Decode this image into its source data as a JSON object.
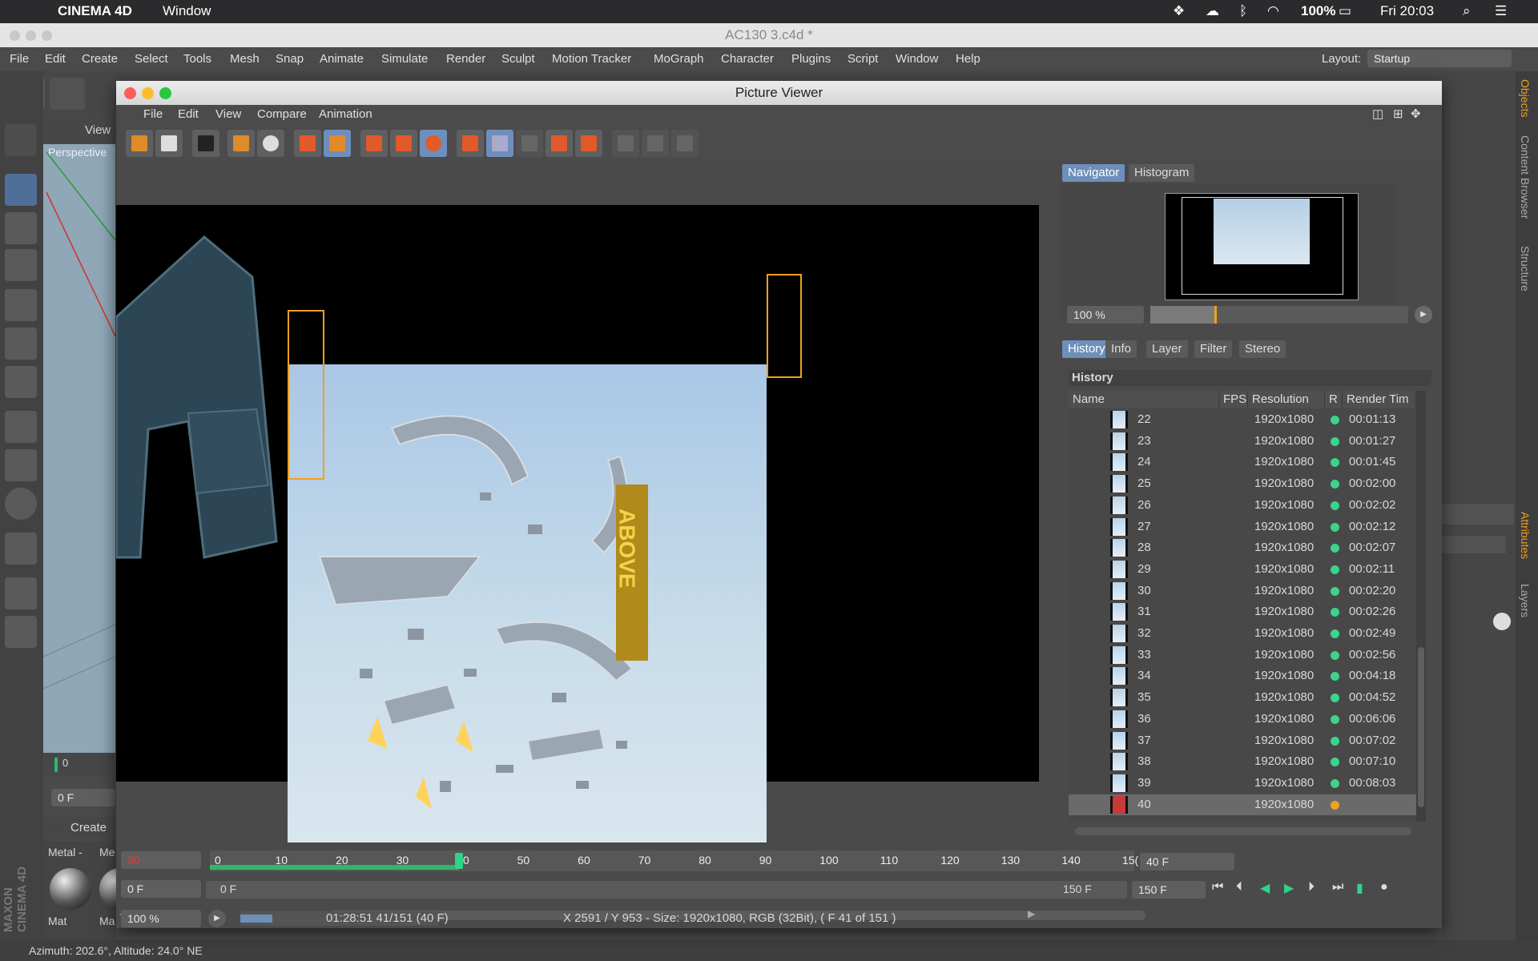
{
  "mac_menubar": {
    "app_name": "CINEMA 4D",
    "menu": "Window",
    "battery": "100%",
    "clock": "Fri 20:03"
  },
  "c4d_window": {
    "title": "AC130 3.c4d *",
    "menu": [
      "File",
      "Edit",
      "Create",
      "Select",
      "Tools",
      "Mesh",
      "Snap",
      "Animate",
      "Simulate",
      "Render",
      "Sculpt",
      "Motion Tracker",
      "MoGraph",
      "Character",
      "Plugins",
      "Script",
      "Window",
      "Help"
    ],
    "layout_label": "Layout:",
    "layout_value": "Startup",
    "viewport_menu": "View",
    "viewport_name": "Perspective",
    "frame_field": "0 F",
    "timeline_start": "0",
    "create_panel": "Create",
    "material_tabs": [
      "Metal -",
      "Me"
    ],
    "material_labels": [
      "Mat",
      "Ma"
    ],
    "side_tabs": [
      "Objects",
      "Content Browser",
      "Structure",
      "Attributes",
      "Layers"
    ],
    "status": "Azimuth: 202.6°, Altitude: 24.0°  NE",
    "maxon_logo": "MAXON CINEMA 4D"
  },
  "picture_viewer": {
    "title": "Picture Viewer",
    "menu": [
      "File",
      "Edit",
      "View",
      "Compare",
      "Animation"
    ],
    "right_tabs_top": [
      "Navigator",
      "Histogram"
    ],
    "zoom": "100 %",
    "right_tabs_bottom": [
      "History",
      "Info",
      "Layer",
      "Filter",
      "Stereo"
    ],
    "history_title": "History",
    "columns": [
      "Name",
      "FPS",
      "Resolution",
      "R",
      "Render Tim"
    ],
    "rows": [
      {
        "name": "22",
        "res": "1920x1080",
        "time": "00:01:13",
        "status": "done"
      },
      {
        "name": "23",
        "res": "1920x1080",
        "time": "00:01:27",
        "status": "done"
      },
      {
        "name": "24",
        "res": "1920x1080",
        "time": "00:01:45",
        "status": "done"
      },
      {
        "name": "25",
        "res": "1920x1080",
        "time": "00:02:00",
        "status": "done"
      },
      {
        "name": "26",
        "res": "1920x1080",
        "time": "00:02:02",
        "status": "done"
      },
      {
        "name": "27",
        "res": "1920x1080",
        "time": "00:02:12",
        "status": "done"
      },
      {
        "name": "28",
        "res": "1920x1080",
        "time": "00:02:07",
        "status": "done"
      },
      {
        "name": "29",
        "res": "1920x1080",
        "time": "00:02:11",
        "status": "done"
      },
      {
        "name": "30",
        "res": "1920x1080",
        "time": "00:02:20",
        "status": "done"
      },
      {
        "name": "31",
        "res": "1920x1080",
        "time": "00:02:26",
        "status": "done"
      },
      {
        "name": "32",
        "res": "1920x1080",
        "time": "00:02:49",
        "status": "done"
      },
      {
        "name": "33",
        "res": "1920x1080",
        "time": "00:02:56",
        "status": "done"
      },
      {
        "name": "34",
        "res": "1920x1080",
        "time": "00:04:18",
        "status": "done"
      },
      {
        "name": "35",
        "res": "1920x1080",
        "time": "00:04:52",
        "status": "done"
      },
      {
        "name": "36",
        "res": "1920x1080",
        "time": "00:06:06",
        "status": "done"
      },
      {
        "name": "37",
        "res": "1920x1080",
        "time": "00:07:02",
        "status": "done"
      },
      {
        "name": "38",
        "res": "1920x1080",
        "time": "00:07:10",
        "status": "done"
      },
      {
        "name": "39",
        "res": "1920x1080",
        "time": "00:08:03",
        "status": "done"
      },
      {
        "name": "40",
        "res": "1920x1080",
        "time": "",
        "status": "rendering"
      }
    ],
    "timeline": {
      "current_field": "30",
      "start_field": "0 F",
      "zoom_field": "100 %",
      "ticks": [
        "0",
        "10",
        "20",
        "30",
        "40",
        "50",
        "60",
        "70",
        "80",
        "90",
        "100",
        "110",
        "120",
        "130",
        "140",
        "15("
      ],
      "current_frame_label": "40",
      "end_field": "40 F",
      "range_start": "0 F",
      "range_end": "150 F",
      "range_end_field": "150 F",
      "progress_info": "01:28:51 41/151 (40 F)",
      "image_info": "X 2591 / Y 953 - Size: 1920x1080, RGB (32Bit),  ( F 41 of 151 )"
    }
  },
  "colors": {
    "accent": "#6d8fbb",
    "done": "#3cd38a",
    "rendering": "#f0a020",
    "timeline_green": "#2fb86a"
  }
}
